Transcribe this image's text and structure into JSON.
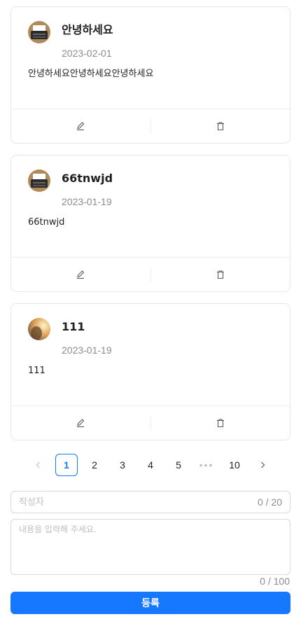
{
  "comments": [
    {
      "author": "안녕하세요",
      "date": "2023-02-01",
      "content": "안녕하세요안녕하세요안녕하세요",
      "avatar": "typewriter"
    },
    {
      "author": "66tnwjd",
      "date": "2023-01-19",
      "content": "66tnwjd",
      "avatar": "typewriter"
    },
    {
      "author": "111",
      "date": "2023-01-19",
      "content": "111",
      "avatar": "sunset-portrait"
    }
  ],
  "pagination": {
    "pages": [
      "1",
      "2",
      "3",
      "4",
      "5",
      "10"
    ],
    "current": "1",
    "ellipsis": "•••"
  },
  "form": {
    "writer_placeholder": "작성자",
    "writer_counter": "0 / 20",
    "content_placeholder": "내용을 입력해 주세요.",
    "content_counter": "0 / 100",
    "submit_label": "등록"
  },
  "colors": {
    "primary": "#1677ff",
    "border": "#d9d9d9",
    "muted": "#8c8c8c"
  }
}
